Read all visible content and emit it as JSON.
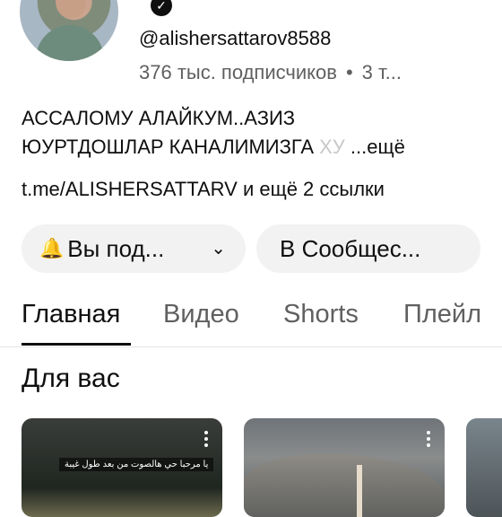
{
  "channel": {
    "handle": "@alishersattarov8588",
    "subscribers": "376 тыс. подписчиков",
    "meta_separator": "•",
    "meta_extra": "3 т...",
    "verified_icon": "check-circle-icon"
  },
  "description": {
    "line1": "АССАЛОМУ АЛАЙКУМ..АЗИЗ",
    "line2": "ЮУРТДОШЛАР КАНАЛИМИЗГА",
    "line2_fade": "ХУ",
    "more": "...ещё"
  },
  "links": {
    "main": "t.me/ALISHERSATTARV",
    "more": "и ещё 2 ссылки"
  },
  "buttons": {
    "subscribed": "Вы под...",
    "community": "В Сообщес..."
  },
  "tabs": [
    "Главная",
    "Видео",
    "Shorts",
    "Плейл"
  ],
  "section": {
    "title": "Для вас"
  },
  "thumbnails": [
    {
      "overlay_text": "يا مرحبا حي هالصوت من بعد طول غيبة"
    },
    {
      "overlay_text": ""
    },
    {
      "overlay_text": ""
    }
  ]
}
